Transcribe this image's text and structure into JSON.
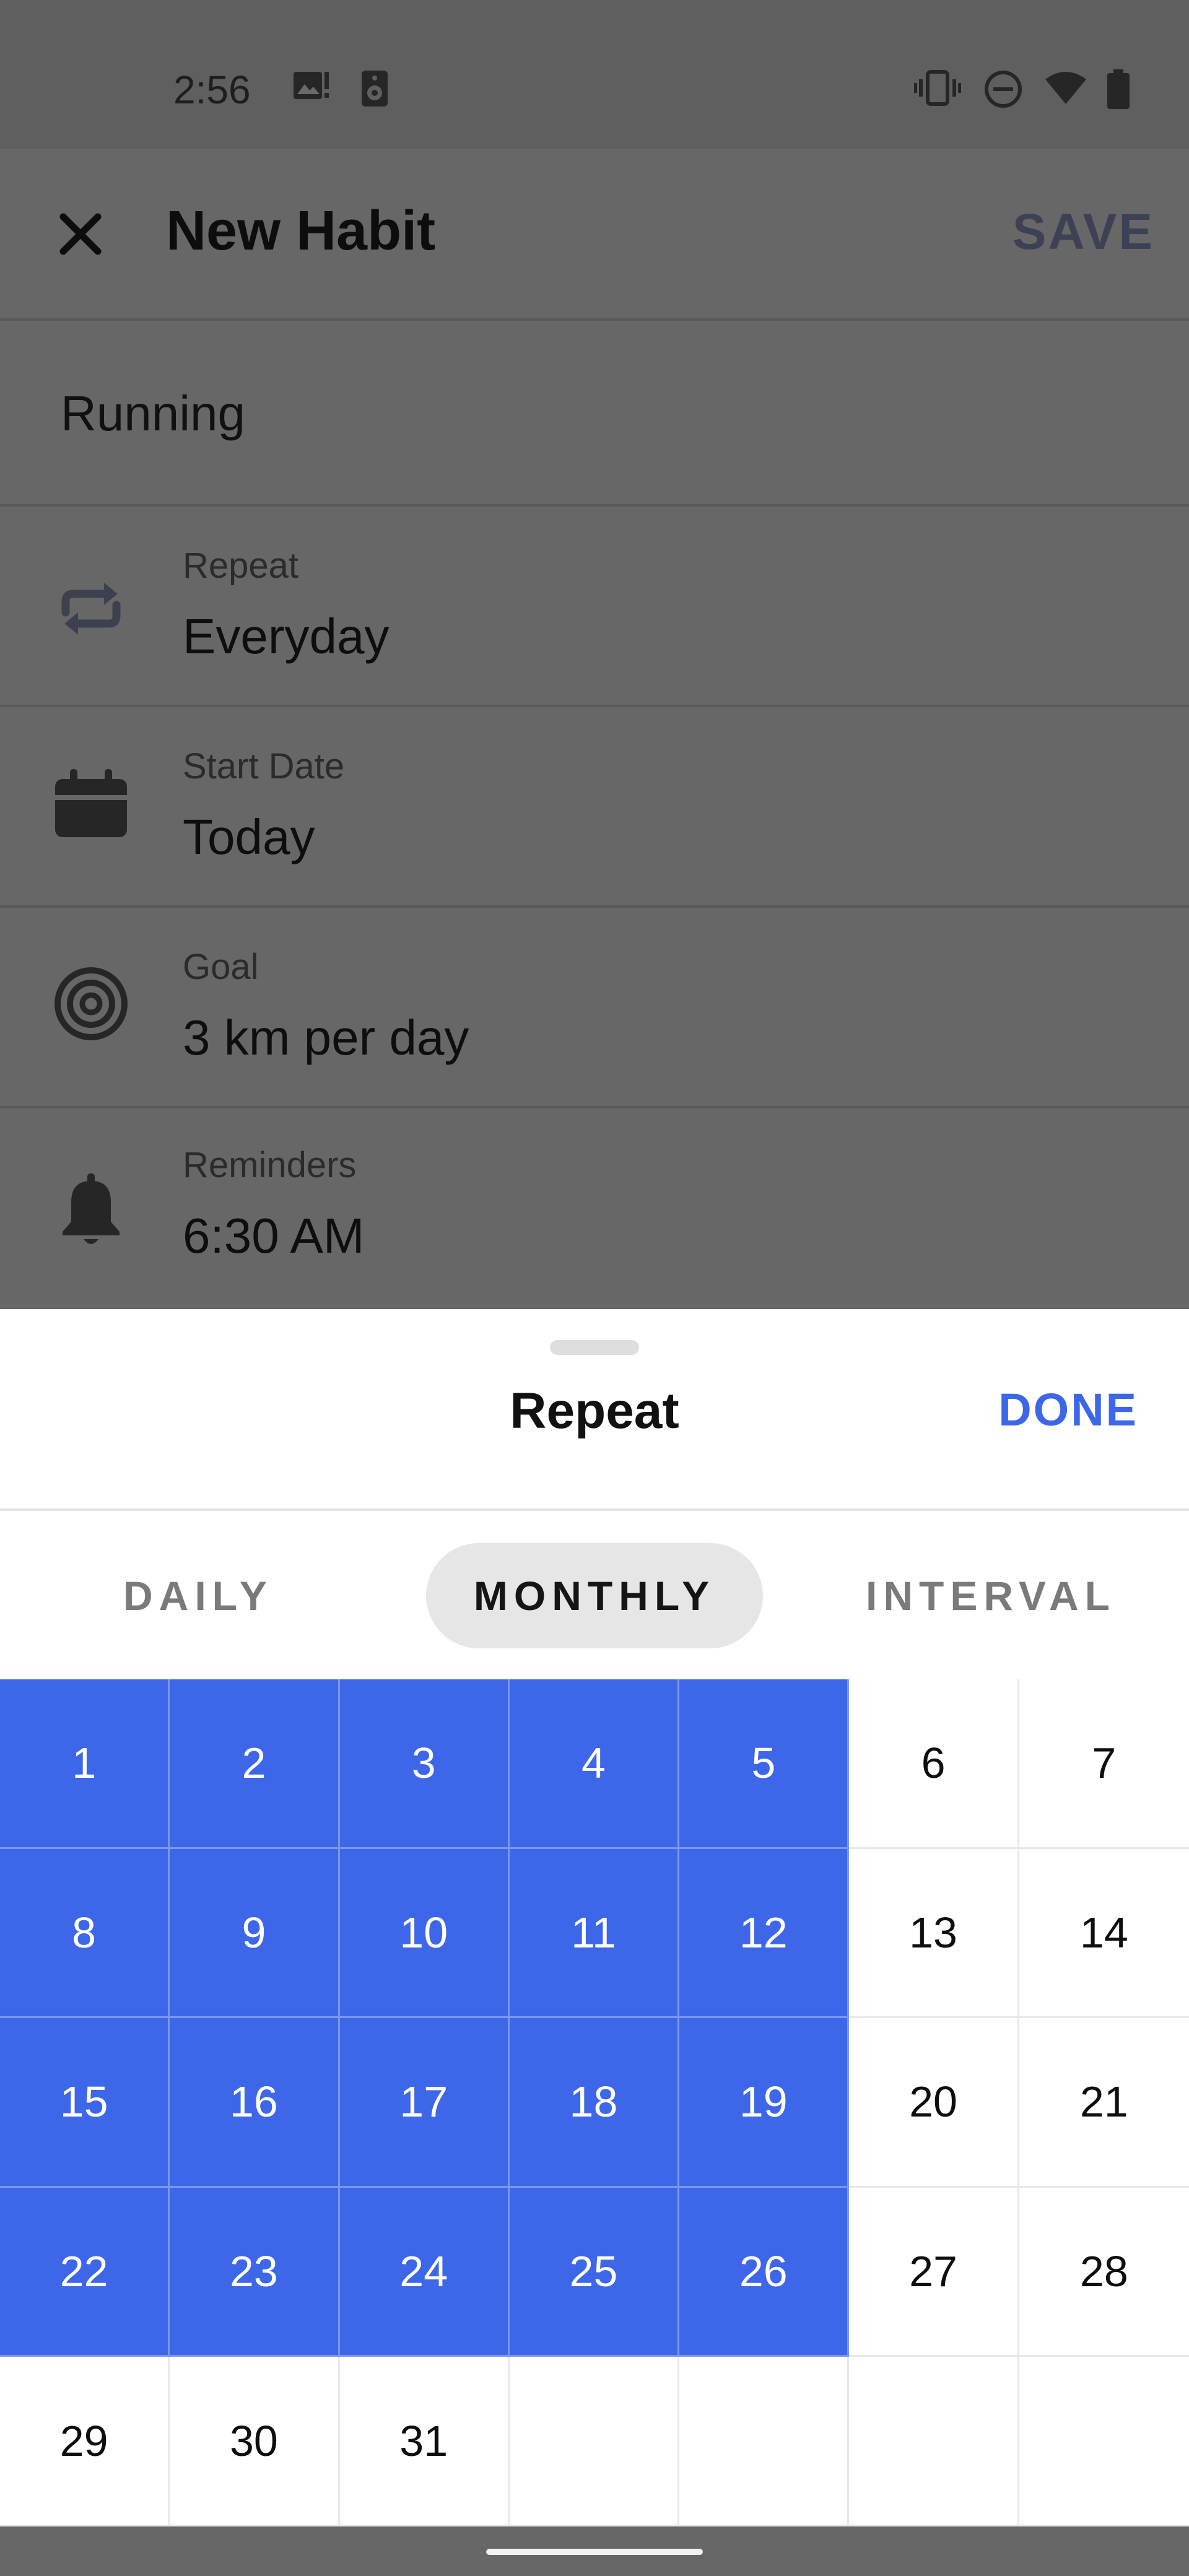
{
  "status": {
    "time": "2:56",
    "icons": [
      "image-notification-icon",
      "speaker-icon",
      "vibrate-icon",
      "dnd-icon",
      "wifi-icon",
      "battery-icon"
    ]
  },
  "header": {
    "title": "New Habit",
    "save_label": "SAVE",
    "close_icon": "close-icon"
  },
  "habit_name": "Running",
  "fields": [
    {
      "label": "Repeat",
      "value": "Everyday",
      "icon": "repeat-icon"
    },
    {
      "label": "Start Date",
      "value": "Today",
      "icon": "calendar-icon"
    },
    {
      "label": "Goal",
      "value": "3 km per day",
      "icon": "target-icon"
    },
    {
      "label": "Reminders",
      "value": "6:30 AM",
      "icon": "bell-icon"
    }
  ],
  "sheet": {
    "title": "Repeat",
    "done_label": "DONE",
    "tabs": [
      "DAILY",
      "MONTHLY",
      "INTERVAL"
    ],
    "active_tab": "MONTHLY",
    "days": [
      "1",
      "2",
      "3",
      "4",
      "5",
      "6",
      "7",
      "8",
      "9",
      "10",
      "11",
      "12",
      "13",
      "14",
      "15",
      "16",
      "17",
      "18",
      "19",
      "20",
      "21",
      "22",
      "23",
      "24",
      "25",
      "26",
      "27",
      "28",
      "29",
      "30",
      "31"
    ],
    "selected_days": [
      1,
      2,
      3,
      4,
      5,
      8,
      9,
      10,
      11,
      12,
      15,
      16,
      17,
      18,
      19,
      22,
      23,
      24,
      25,
      26
    ]
  },
  "colors": {
    "accent": "#3d67e8",
    "scrim": "#676767",
    "tab_active_bg": "#e6e6e6"
  }
}
